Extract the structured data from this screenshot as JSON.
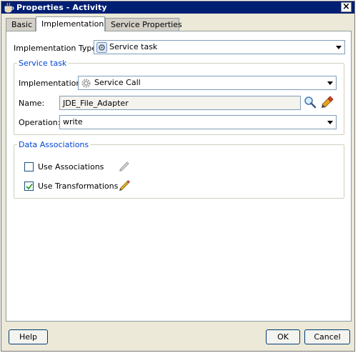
{
  "window": {
    "title": "Properties - Activity"
  },
  "tabs": [
    {
      "label": "Basic"
    },
    {
      "label": "Implementation"
    },
    {
      "label": "Service Properties"
    }
  ],
  "implementation_type": {
    "label": "Implementation Type:",
    "value": "Service task"
  },
  "service_task": {
    "title": "Service task",
    "implementation": {
      "label": "Implementation:",
      "value": "Service Call"
    },
    "name": {
      "label": "Name:",
      "value": "JDE_File_Adapter"
    },
    "operation": {
      "label": "Operation:",
      "value": "write"
    }
  },
  "data_associations": {
    "title": "Data Associations",
    "use_associations": {
      "label": "Use Associations",
      "checked": false
    },
    "use_transformations": {
      "label": "Use Transformations",
      "checked": true
    }
  },
  "buttons": {
    "help": "Help",
    "ok": "OK",
    "cancel": "Cancel"
  }
}
